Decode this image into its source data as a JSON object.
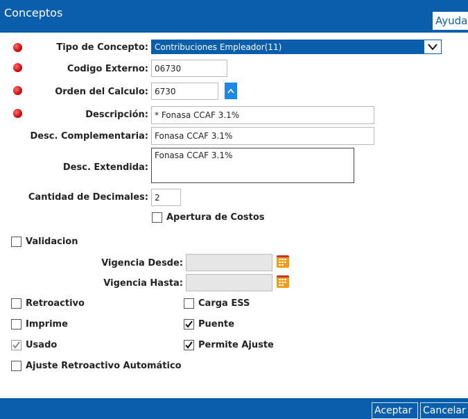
{
  "window": {
    "title": "Conceptos",
    "help_label": "Ayuda"
  },
  "form": {
    "tipo_concepto": {
      "label": "Tipo de Concepto:",
      "value": "Contribuciones Empleador(11)"
    },
    "codigo_externo": {
      "label": "Codigo Externo:",
      "value": "06730"
    },
    "orden_calculo": {
      "label": "Orden del Calculo:",
      "value": "6730"
    },
    "descripcion": {
      "label": "Descripción:",
      "value": "* Fonasa CCAF 3.1%"
    },
    "desc_complementaria": {
      "label": "Desc. Complementaria:",
      "value": "Fonasa CCAF 3.1%"
    },
    "desc_extendida": {
      "label": "Desc. Extendida:",
      "value": "Fonasa CCAF 3.1%"
    },
    "cantidad_decimales": {
      "label": "Cantidad de Decimales:",
      "value": "2"
    },
    "apertura_costos": {
      "label": "Apertura de Costos",
      "checked": false
    },
    "validacion": {
      "label": "Validacion",
      "checked": false
    },
    "vigencia_desde": {
      "label": "Vigencia Desde:",
      "value": ""
    },
    "vigencia_hasta": {
      "label": "Vigencia Hasta:",
      "value": ""
    },
    "retroactivo": {
      "label": "Retroactivo",
      "checked": false
    },
    "carga_ess": {
      "label": "Carga ESS",
      "checked": false
    },
    "imprime": {
      "label": "Imprime",
      "checked": false
    },
    "puente": {
      "label": "Puente",
      "checked": true
    },
    "usado": {
      "label": "Usado",
      "checked": true
    },
    "permite_ajuste": {
      "label": "Permite Ajuste",
      "checked": true
    },
    "ajuste_retroactivo": {
      "label": "Ajuste Retroactivo Automático",
      "checked": false
    }
  },
  "footer": {
    "accept_label": "Aceptar",
    "cancel_label": "Cancelar"
  },
  "colors": {
    "primary": "#0a5eab",
    "required": "#d11a1a",
    "calendar": "#f39c12"
  }
}
